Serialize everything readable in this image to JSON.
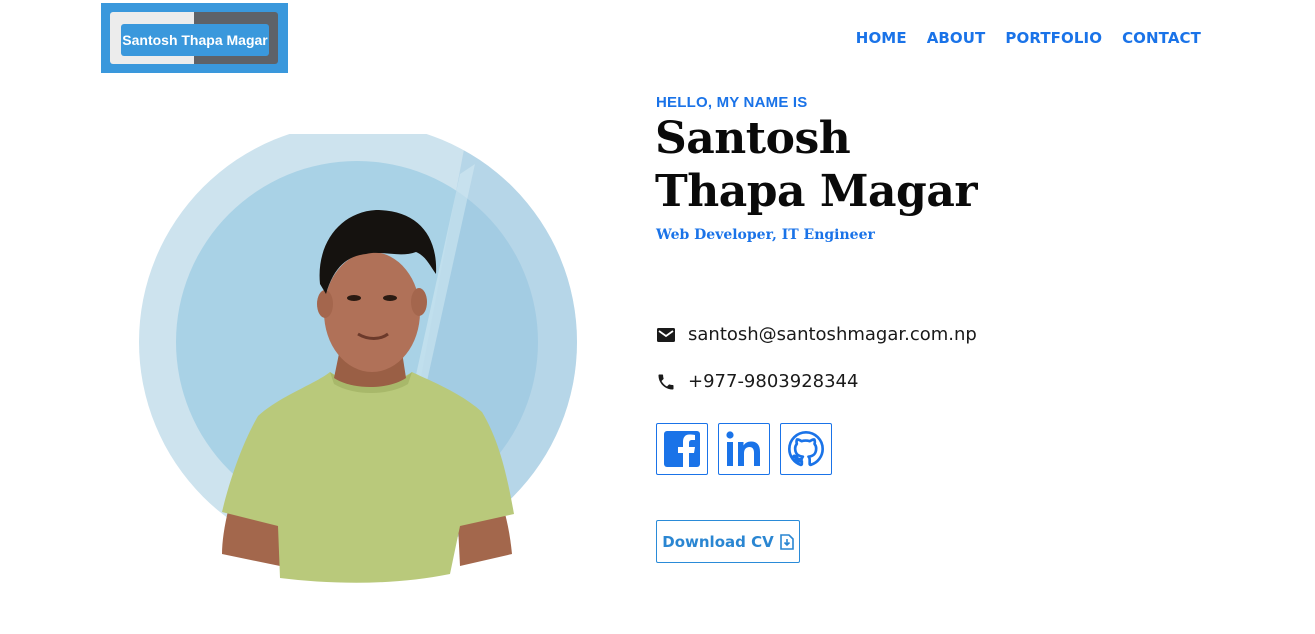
{
  "logo": {
    "text": "Santosh Thapa Magar"
  },
  "nav": {
    "items": [
      {
        "label": "HOME"
      },
      {
        "label": "ABOUT"
      },
      {
        "label": "PORTFOLIO"
      },
      {
        "label": "CONTACT"
      }
    ]
  },
  "hero": {
    "greeting": "HELLO, MY NAME IS",
    "name_line1": "Santosh",
    "name_line2": "Thapa Magar",
    "role": "Web Developer, IT Engineer",
    "email": "santosh@santoshmagar.com.np",
    "phone": "+977-9803928344",
    "socials": [
      {
        "icon": "facebook-icon"
      },
      {
        "icon": "linkedin-icon"
      },
      {
        "icon": "github-icon"
      }
    ],
    "cv_button": "Download CV"
  },
  "colors": {
    "accent": "#1a73e8",
    "logo_bg": "#3a98dc",
    "circle_outer": "#c7dfec",
    "circle_inner": "#a9d2e6",
    "shirt": "#b9c97b"
  }
}
